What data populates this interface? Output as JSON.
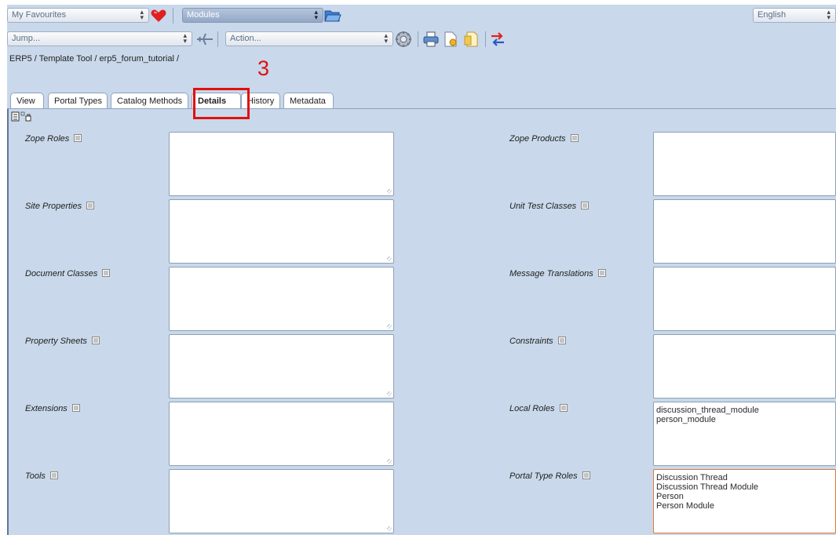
{
  "toolbar": {
    "favourites_select": "My Favourites",
    "modules_select": "Modules",
    "language_select": "English",
    "jump_select": "Jump...",
    "action_select": "Action..."
  },
  "breadcrumb": "ERP5 / Template Tool / erp5_forum_tutorial /",
  "annotation_number": "3",
  "tabs": [
    {
      "label": "View"
    },
    {
      "label": "Portal Types"
    },
    {
      "label": "Catalog Methods"
    },
    {
      "label": "Details"
    },
    {
      "label": "History"
    },
    {
      "label": "Metadata"
    }
  ],
  "fields": {
    "zope_roles": {
      "label": "Zope Roles"
    },
    "site_properties": {
      "label": "Site Properties"
    },
    "document_classes": {
      "label": "Document Classes"
    },
    "property_sheets": {
      "label": "Property Sheets"
    },
    "extensions": {
      "label": "Extensions"
    },
    "tools": {
      "label": "Tools"
    },
    "zope_products": {
      "label": "Zope Products"
    },
    "unit_test_classes": {
      "label": "Unit Test Classes"
    },
    "message_translations": {
      "label": "Message Translations"
    },
    "constraints": {
      "label": "Constraints"
    },
    "local_roles": {
      "label": "Local Roles",
      "lines": [
        "discussion_thread_module",
        "person_module"
      ]
    },
    "portal_type_roles": {
      "label": "Portal Type Roles",
      "lines": [
        "Discussion Thread",
        "Discussion Thread Module",
        "Person",
        "Person Module"
      ]
    }
  },
  "colors": {
    "accent_red": "#e0100f",
    "panel_blue": "#c9d8ea",
    "highlight_orange": "#e0782f"
  }
}
